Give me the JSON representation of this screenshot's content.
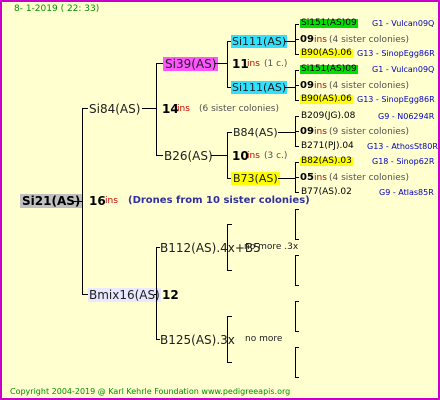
{
  "header": "8-  1-2019 ( 22: 33)",
  "root": {
    "name": "Si21(AS)",
    "num": "16",
    "ins": "ins",
    "note": "(Drones from 10 sister colonies)"
  },
  "si84": {
    "name": "Si84(AS)",
    "num": "14",
    "ins": "ins",
    "note": "(6 sister colonies)"
  },
  "si39": {
    "name": "Si39(AS)",
    "num": "11",
    "ins": "ins",
    "note": "(1 c.)"
  },
  "si111a": {
    "name": "Si111(AS)"
  },
  "si111b": {
    "name": "Si111(AS)"
  },
  "b26": {
    "name": "B26(AS)",
    "num": "10",
    "ins": "ins",
    "note": "(3 c.)"
  },
  "b84": {
    "name": "B84(AS)"
  },
  "b73": {
    "name": "B73(AS)"
  },
  "gen5": [
    {
      "bee": "Si151(AS)09",
      "info": "G1 - Vulcan09Q"
    },
    {
      "num": "09",
      "ins": "ins",
      "note": "(4 sister colonies)"
    },
    {
      "bee": "B90(AS).06",
      "info": "G13 - SinopEgg86R"
    },
    {
      "bee": "Si151(AS)09",
      "info": "G1 - Vulcan09Q"
    },
    {
      "num": "09",
      "ins": "ins",
      "note": "(4 sister colonies)"
    },
    {
      "bee": "B90(AS).06",
      "info": "G13 - SinopEgg86R"
    },
    {
      "bee": "B209(JG).08",
      "info": "G9 - N06294R"
    },
    {
      "num": "09",
      "ins": "ins",
      "note": "(9 sister colonies)"
    },
    {
      "bee": "B271(PJ).04",
      "info": "G13 - AthosSt80R"
    },
    {
      "bee": "B82(AS).03",
      "info": "G18 - Sinop62R"
    },
    {
      "num": "05",
      "ins": "ins",
      "note": "(4 sister colonies)"
    },
    {
      "bee": "B77(AS).02",
      "info": "G9 - Atlas85R"
    }
  ],
  "bmix": {
    "name": "Bmix16(AS)",
    "num": "12"
  },
  "b112": {
    "name": "B112(AS).4x+B5",
    "note": "no more .3x"
  },
  "b125": {
    "name": "B125(AS).3x",
    "note": "no more"
  },
  "footer": "Copyright 2004-2019 @ Karl Kehrle Foundation    www.pedigreeapis.org"
}
